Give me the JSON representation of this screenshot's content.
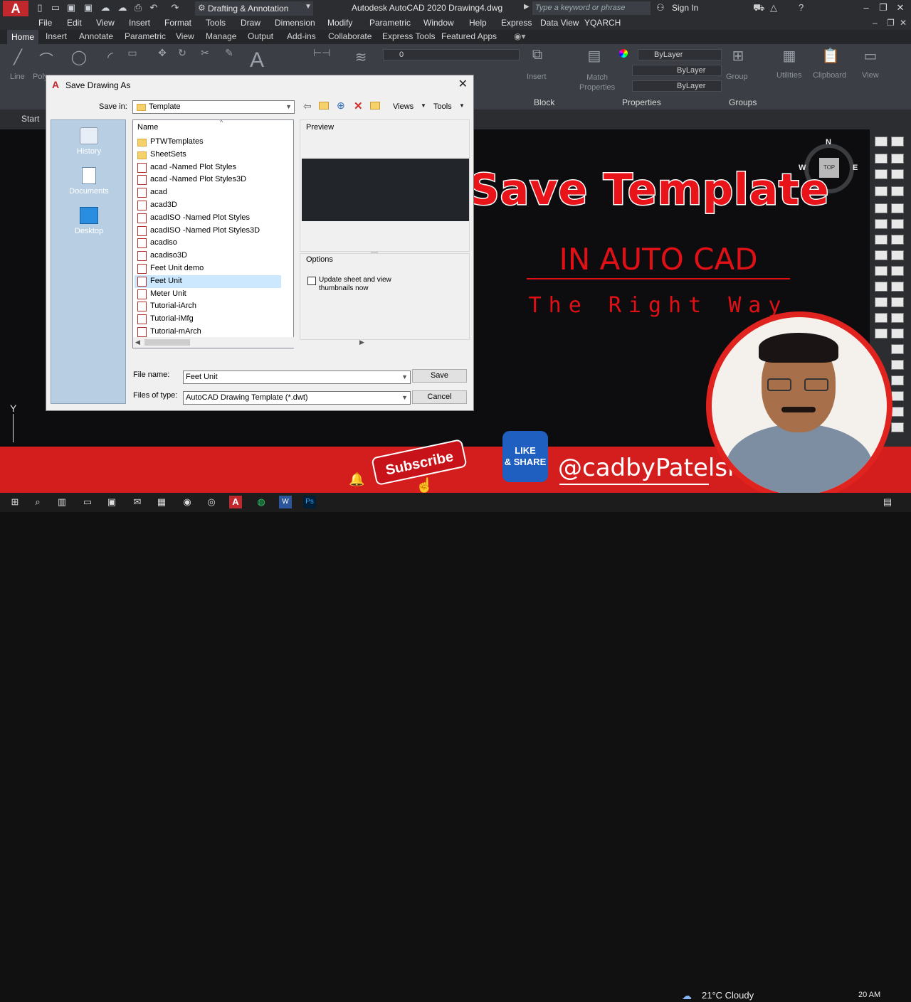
{
  "titlebar": {
    "workspace": "Drafting & Annotation",
    "title": "Autodesk AutoCAD 2020   Drawing4.dwg",
    "search_placeholder": "Type a keyword or phrase",
    "signin": "Sign In"
  },
  "menubar": [
    "File",
    "Edit",
    "View",
    "Insert",
    "Format",
    "Tools",
    "Draw",
    "Dimension",
    "Modify",
    "Parametric",
    "Window",
    "Help",
    "Express",
    "Data View",
    "YQARCH"
  ],
  "tabs": [
    "Home",
    "Insert",
    "Annotate",
    "Parametric",
    "View",
    "Manage",
    "Output",
    "Add-ins",
    "Collaborate",
    "Express Tools",
    "Featured Apps"
  ],
  "ribbon": {
    "draw_labels": [
      "Line",
      "Poly"
    ],
    "layer_value": "0",
    "block_label": "Insert",
    "block_panel": "Block",
    "match_label": "Match\nProperties",
    "bylayer": [
      "ByLayer",
      "ByLayer",
      "ByLayer"
    ],
    "properties_panel": "Properties",
    "group_label": "Group",
    "groups_panel": "Groups",
    "utilities": "Utilities",
    "clipboard": "Clipboard",
    "view": "View"
  },
  "filetab": "Start",
  "dialog": {
    "title": "Save Drawing As",
    "save_in_label": "Save in:",
    "save_in_value": "Template",
    "views": "Views",
    "tools": "Tools",
    "places": [
      "History",
      "Documents",
      "Desktop"
    ],
    "name_header": "Name",
    "files": [
      {
        "name": "PTWTemplates",
        "type": "folder"
      },
      {
        "name": "SheetSets",
        "type": "folder"
      },
      {
        "name": "acad -Named Plot Styles",
        "type": "dwt"
      },
      {
        "name": "acad -Named Plot Styles3D",
        "type": "dwt"
      },
      {
        "name": "acad",
        "type": "dwt"
      },
      {
        "name": "acad3D",
        "type": "dwt"
      },
      {
        "name": "acadISO -Named Plot Styles",
        "type": "dwt"
      },
      {
        "name": "acadISO -Named Plot Styles3D",
        "type": "dwt"
      },
      {
        "name": "acadiso",
        "type": "dwt"
      },
      {
        "name": "acadiso3D",
        "type": "dwt"
      },
      {
        "name": "Feet Unit demo",
        "type": "dwt"
      },
      {
        "name": "Feet Unit",
        "type": "dwt",
        "selected": true
      },
      {
        "name": "Meter Unit",
        "type": "dwt"
      },
      {
        "name": "Tutorial-iArch",
        "type": "dwt"
      },
      {
        "name": "Tutorial-iMfg",
        "type": "dwt"
      },
      {
        "name": "Tutorial-mArch",
        "type": "dwt"
      }
    ],
    "preview_label": "Preview",
    "options_label": "Options",
    "update_thumbnails": "Update sheet and view\nthumbnails now",
    "file_name_label": "File name:",
    "file_name_value": "Feet Unit",
    "files_of_type_label": "Files of type:",
    "files_of_type_value": "AutoCAD Drawing Template (*.dwt)",
    "save_button": "Save",
    "cancel_button": "Cancel"
  },
  "overlay": {
    "title": "Save Template",
    "subtitle": "IN AUTO CAD",
    "tagline": "The Right Way"
  },
  "navcube": {
    "n": "N",
    "w": "W",
    "e": "E",
    "top": "TOP"
  },
  "ucs": "Y",
  "banner": {
    "subscribe": "Subscribe",
    "like_share": "LIKE\n& SHARE",
    "handle": "@cadbyPatelsir"
  },
  "taskbar": {
    "weather": "21°C  Cloudy",
    "clock": "20 AM"
  },
  "colors": {
    "accent": "#d41d1d",
    "overlay_red": "#e8141a",
    "dialog_bg": "#f0f0f0",
    "selection": "#cce8ff"
  }
}
